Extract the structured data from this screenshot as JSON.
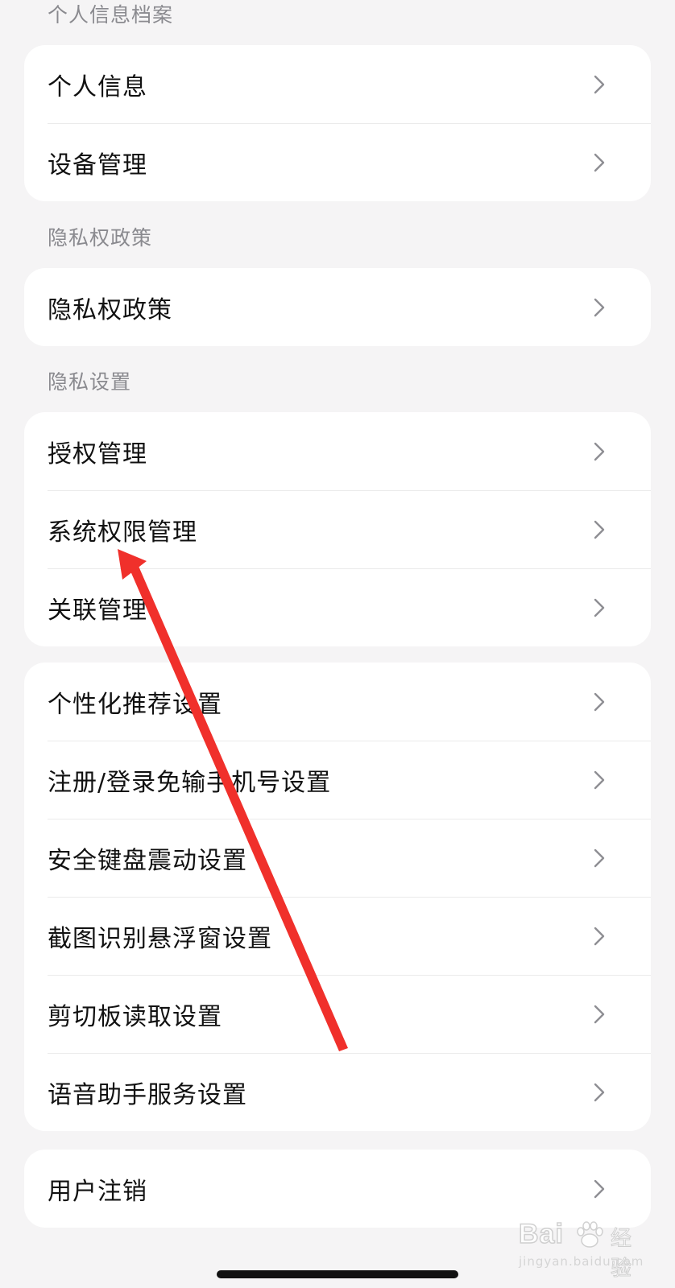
{
  "sections": [
    {
      "header": "个人信息档案",
      "items": [
        "个人信息",
        "设备管理"
      ]
    },
    {
      "header": "隐私权政策",
      "items": [
        "隐私权政策"
      ]
    },
    {
      "header": "隐私设置",
      "items": [
        "授权管理",
        "系统权限管理",
        "关联管理"
      ]
    },
    {
      "header": "",
      "items": [
        "个性化推荐设置",
        "注册/登录免输手机号设置",
        "安全键盘震动设置",
        "截图识别悬浮窗设置",
        "剪切板读取设置",
        "语音助手服务设置"
      ]
    },
    {
      "header": "",
      "items": [
        "用户注销"
      ]
    }
  ],
  "icons": {
    "row_chevron": "chevron-right-icon",
    "watermark_logo": "baidu-paw-icon"
  },
  "annotation": {
    "color": "#f0302b",
    "points_to": "系统权限管理"
  },
  "watermark": {
    "brand": "Bai",
    "product": "经验",
    "url": "jingyan.baidu.com"
  }
}
